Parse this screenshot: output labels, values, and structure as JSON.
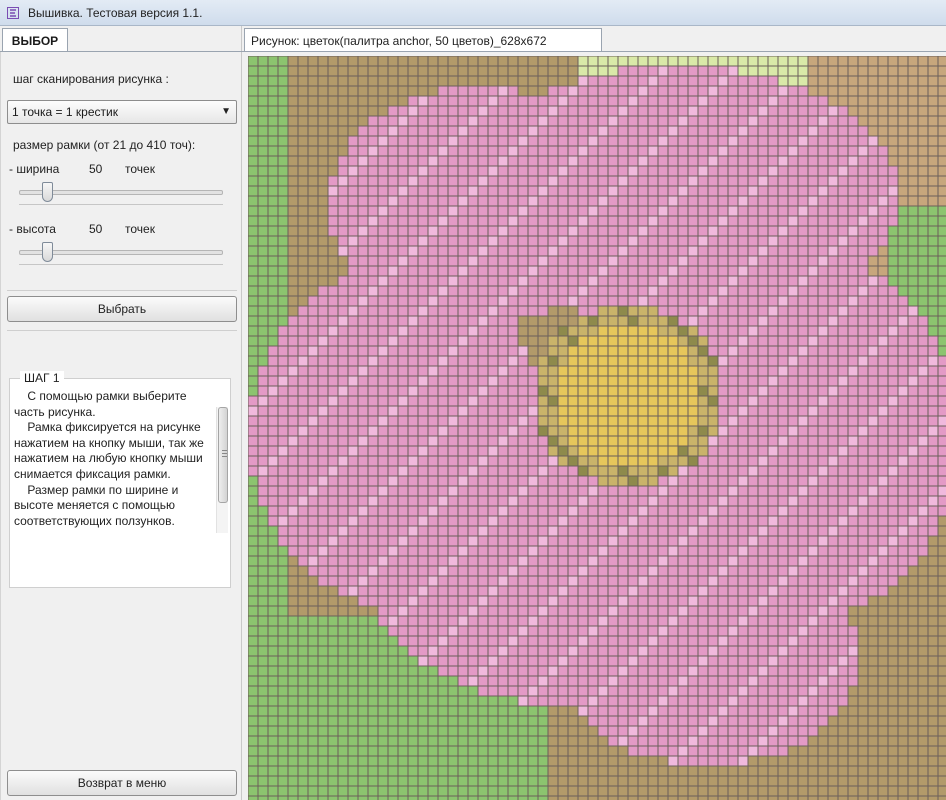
{
  "window": {
    "title": "Вышивка. Тестовая версия 1.1.",
    "icon": "embroidery-app-icon"
  },
  "left_panel": {
    "tab_label": "ВЫБОР",
    "scan_step_label": "шаг сканирования рисунка :",
    "scan_step_value": "1 точка = 1 крестик",
    "frame_size_label": "размер рамки (от 21 до 410 точ):",
    "width": {
      "label": "- ширина",
      "value": "50",
      "unit": "точек",
      "slider_fraction": 0.05
    },
    "height": {
      "label": "- высота",
      "value": "50",
      "unit": "точек",
      "slider_fraction": 0.05
    },
    "select_button": "Выбрать",
    "help": {
      "title": "ШАГ 1",
      "text": "    С помощью рамки выберите часть рисунка.\n    Рамка фиксируется на рисунке нажатием на кнопку мыши, так же нажатием на любую кнопку мыши снимается фиксация рамки.\n    Размер рамки по ширине и высоте меняется с помощью соответствующих ползунков."
    },
    "back_button": "Возврат в меню"
  },
  "right_panel": {
    "tab_label": "Рисунок: цветок(палитра anchor, 50 цветов)_628х672"
  },
  "colors": {
    "petal_pink": "#e39ac6",
    "petal_light": "#f0b9dd",
    "leaf_green": "#8cc46f",
    "soil_brown": "#b29a6a",
    "center_yellow": "#e6c65b",
    "grid_line": "#6b5f5a"
  }
}
